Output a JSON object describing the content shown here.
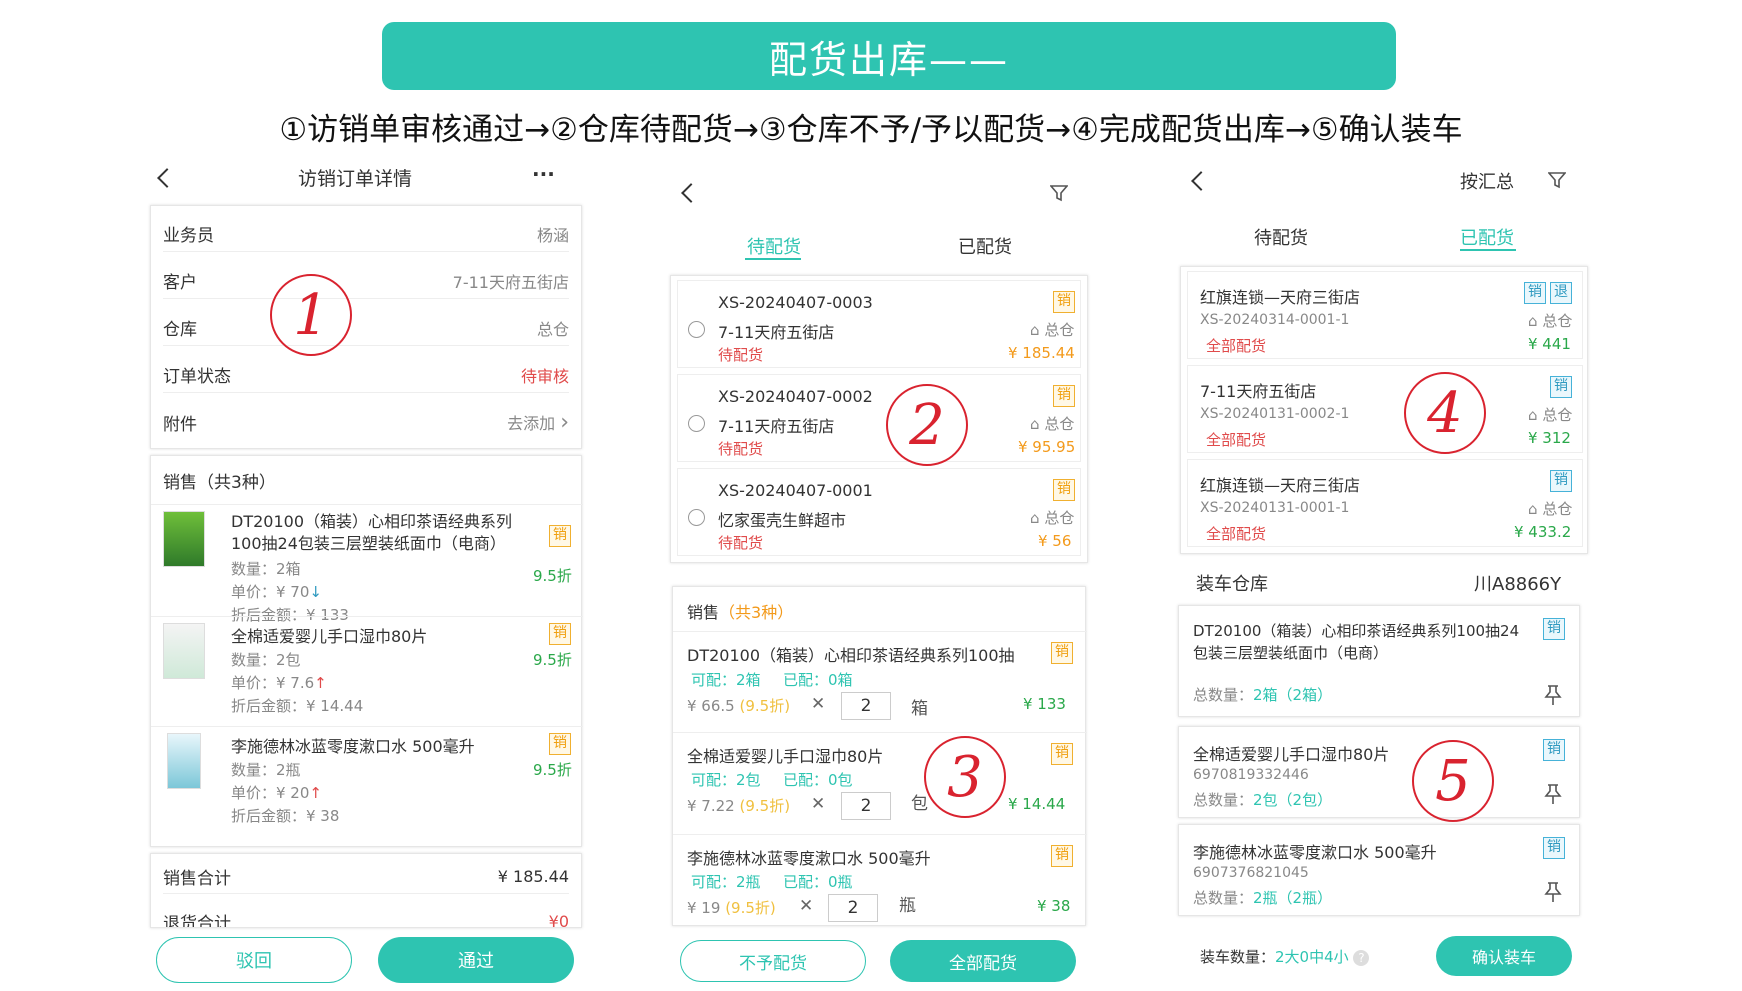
{
  "banner": {
    "title": "配货出库——"
  },
  "flow": {
    "text": "①访销单审核通过→②仓库待配货→③仓库不予/予以配货→④完成配货出库→⑤确认装车"
  },
  "colors": {
    "accent": "#2ec4b1",
    "red": "#e04b4b",
    "orange": "#f39a1b",
    "green": "#2aa84a"
  },
  "p1": {
    "title": "访销订单详情",
    "more": "···",
    "rows": [
      {
        "label": "业务员",
        "value": "杨涵"
      },
      {
        "label": "客户",
        "value": "7-11天府五街店"
      },
      {
        "label": "仓库",
        "value": "总仓"
      },
      {
        "label": "订单状态",
        "value": "待审核"
      },
      {
        "label": "附件",
        "value": "去添加"
      }
    ],
    "sales_header": "销售（共3种）",
    "items": [
      {
        "name": "DT20100（箱装）心相印茶语经典系列100抽24包装三层塑装纸面巾（电商）",
        "badge": "销",
        "discount": "9.5折",
        "qty": "数量：2箱",
        "price": "单价：¥ 70",
        "arrow": "↓",
        "amount": "折后金额：¥ 133"
      },
      {
        "name": "全棉适爱婴儿手口湿巾80片",
        "badge": "销",
        "discount": "9.5折",
        "qty": "数量：2包",
        "price": "单价：¥ 7.6",
        "arrow": "↑",
        "amount": "折后金额：¥ 14.44"
      },
      {
        "name": "李施德林冰蓝零度漱口水 500毫升",
        "badge": "销",
        "discount": "9.5折",
        "qty": "数量：2瓶",
        "price": "单价：¥ 20",
        "arrow": "↑",
        "amount": "折后金额：¥ 38"
      }
    ],
    "total_label": "销售合计",
    "total_value": "¥ 185.44",
    "return_label": "退货合计",
    "return_value": "¥0",
    "reject_btn": "驳回",
    "pass_btn": "通过",
    "step": "1"
  },
  "p2": {
    "tab1": "待配货",
    "tab2": "已配货",
    "orders": [
      {
        "no": "XS-20240407-0003",
        "store": "7-11天府五街店",
        "status": "待配货",
        "wh": "总仓",
        "amount": "¥ 185.44",
        "badge": "销"
      },
      {
        "no": "XS-20240407-0002",
        "store": "7-11天府五街店",
        "status": "待配货",
        "wh": "总仓",
        "amount": "¥ 95.95",
        "badge": "销"
      },
      {
        "no": "XS-20240407-0001",
        "store": "忆家蛋壳生鲜超市",
        "status": "待配货",
        "wh": "总仓",
        "amount": "¥ 56",
        "badge": "销"
      }
    ],
    "sales_label": "销售",
    "sales_count": "（共3种）",
    "lines": [
      {
        "name": "DT20100（箱装）心相印茶语经典系列100抽",
        "badge": "销",
        "can": "可配：2箱",
        "done": "已配：0箱",
        "price": "¥ 66.5",
        "disc": "(9.5折)",
        "x": "✕",
        "qty": "2",
        "unit": "箱",
        "total": "¥ 133"
      },
      {
        "name": "全棉适爱婴儿手口湿巾80片",
        "badge": "销",
        "can": "可配：2包",
        "done": "已配：0包",
        "price": "¥ 7.22",
        "disc": "(9.5折)",
        "x": "✕",
        "qty": "2",
        "unit": "包",
        "total": "¥ 14.44"
      },
      {
        "name": "李施德林冰蓝零度漱口水 500毫升",
        "badge": "销",
        "can": "可配：2瓶",
        "done": "已配：0瓶",
        "price": "¥ 19",
        "disc": "(9.5折)",
        "x": "✕",
        "qty": "2",
        "unit": "瓶",
        "total": "¥ 38"
      }
    ],
    "no_btn": "不予配货",
    "all_btn": "全部配货",
    "step2": "2",
    "step3": "3"
  },
  "p3": {
    "summary": "按汇总",
    "tab1": "待配货",
    "tab2": "已配货",
    "orders": [
      {
        "store": "红旗连锁—天府三街店",
        "no": "XS-20240314-0001-1",
        "status": "全部配货",
        "wh": "总仓",
        "amount": "¥ 441",
        "badge": "销",
        "badge2": "退"
      },
      {
        "store": "7-11天府五街店",
        "no": "XS-20240131-0002-1",
        "status": "全部配货",
        "wh": "总仓",
        "amount": "¥ 312",
        "badge": "销",
        "badge2": ""
      },
      {
        "store": "红旗连锁—天府三街店",
        "no": "XS-20240131-0001-1",
        "status": "全部配货",
        "wh": "总仓",
        "amount": "¥ 433.2",
        "badge": "销",
        "badge2": ""
      }
    ],
    "load_label": "装车仓库",
    "load_value": "川A8866Y",
    "items": [
      {
        "name": "DT20100（箱装）心相印茶语经典系列100抽24包装三层塑装纸面巾（电商）",
        "code": "",
        "qty_label": "总数量：",
        "qty": "2箱（2箱）",
        "badge": "销"
      },
      {
        "name": "全棉适爱婴儿手口湿巾80片",
        "code": "6970819332446",
        "qty_label": "总数量：",
        "qty": "2包（2包）",
        "badge": "销"
      },
      {
        "name": "李施德林冰蓝零度漱口水 500毫升",
        "code": "6907376821045",
        "qty_label": "总数量：",
        "qty": "2瓶（2瓶）",
        "badge": "销"
      }
    ],
    "count_label": "装车数量：",
    "count_value": "2大0中4小",
    "confirm_btn": "确认装车",
    "step4": "4",
    "step5": "5"
  }
}
